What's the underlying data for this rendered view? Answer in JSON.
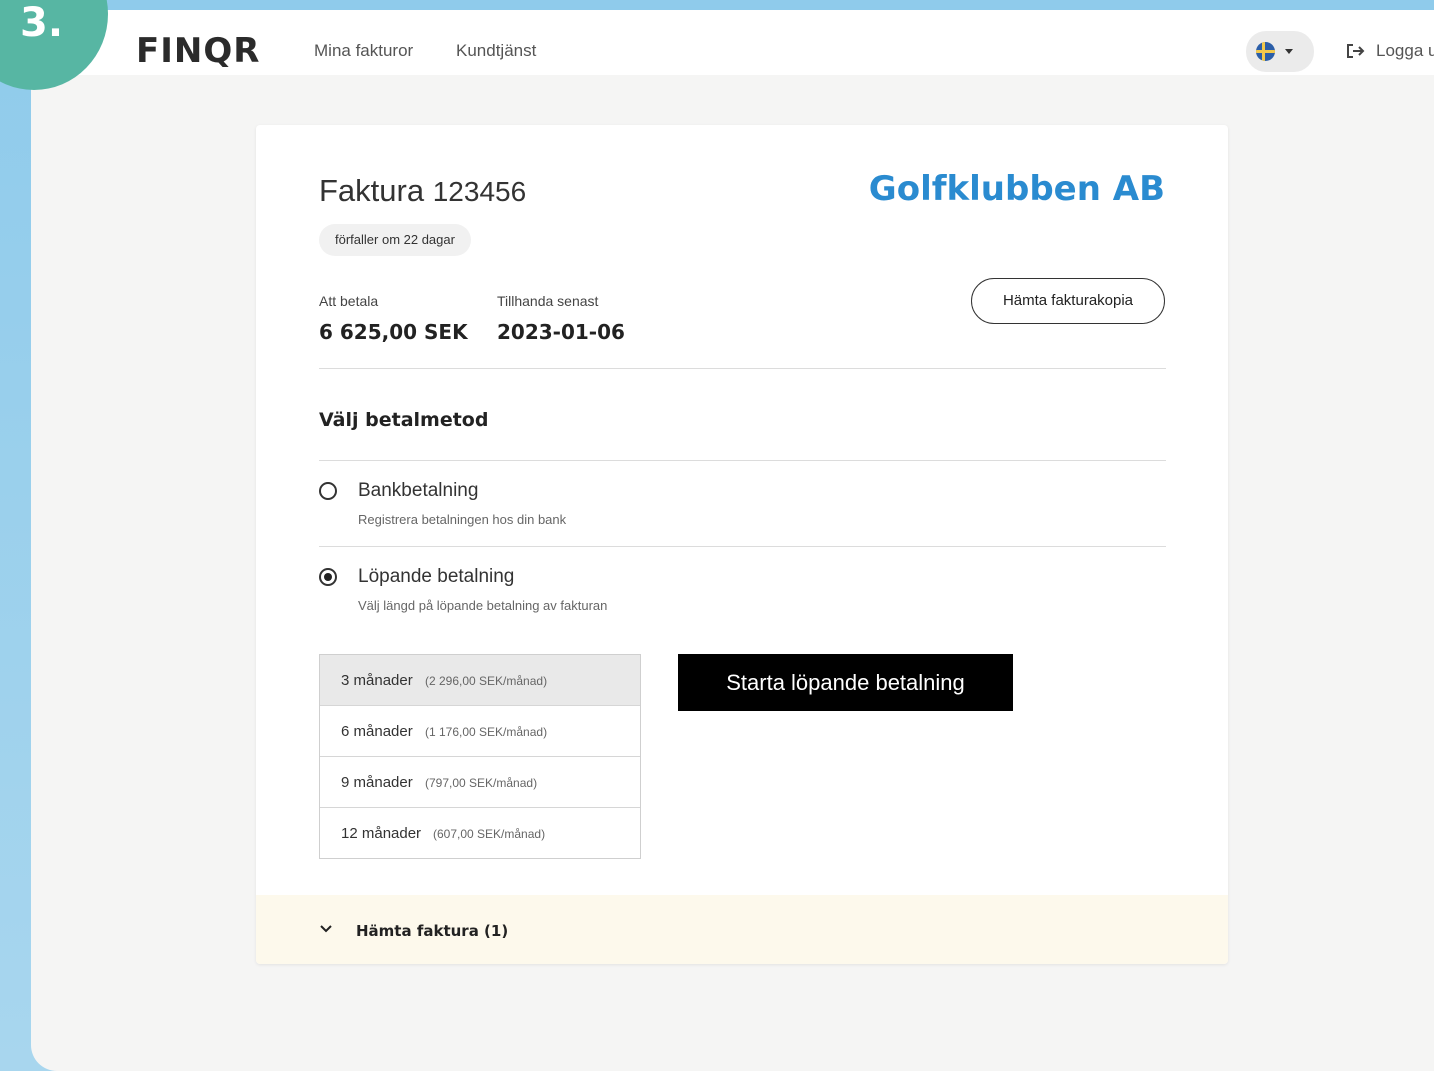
{
  "step": {
    "number": "3."
  },
  "header": {
    "logo": "FINQR",
    "nav": [
      {
        "label": "Mina fakturor"
      },
      {
        "label": "Kundtjänst"
      }
    ],
    "language": {
      "flag_icon": "sweden-flag-icon"
    },
    "logout_label": "Logga u"
  },
  "invoice": {
    "title": "Faktura",
    "number": "123456",
    "company": "Golfklubben AB",
    "due_badge": "förfaller om 22 dagar",
    "amount_label": "Att betala",
    "amount_value": "6 625,00 SEK",
    "deadline_label": "Tillhanda senast",
    "deadline_value": "2023-01-06",
    "copy_button": "Hämta fakturakopia"
  },
  "payment": {
    "section_title": "Välj betalmetod",
    "options": [
      {
        "label": "Bankbetalning",
        "description": "Registrera betalningen hos din bank",
        "selected": false
      },
      {
        "label": "Löpande betalning",
        "description": "Välj längd på löpande betalning av fakturan",
        "selected": true
      }
    ],
    "plans": [
      {
        "months": "3 månader",
        "price": "(2 296,00 SEK/månad)",
        "selected": true
      },
      {
        "months": "6 månader",
        "price": "(1 176,00 SEK/månad)",
        "selected": false
      },
      {
        "months": "9 månader",
        "price": "(797,00 SEK/månad)",
        "selected": false
      },
      {
        "months": "12 månader",
        "price": "(607,00 SEK/månad)",
        "selected": false
      }
    ],
    "start_button": "Starta löpande betalning"
  },
  "footer": {
    "download_label": "Hämta faktura (1)"
  },
  "colors": {
    "accent": "#2a8bd0",
    "badge": "#57b6a3",
    "background_outer": "#9fd2ee",
    "footer_bg": "#fdf9ec"
  }
}
